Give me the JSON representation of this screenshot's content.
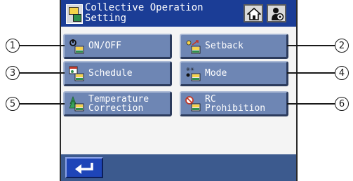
{
  "header": {
    "title": "Collective Operation\nSetting",
    "home_icon": "home-icon",
    "settings_icon": "user-settings-icon"
  },
  "menu": [
    {
      "label": "ON/OFF",
      "icon": "power-remote-icon",
      "callout": "1"
    },
    {
      "label": "Setback",
      "icon": "setback-icon",
      "callout": "2"
    },
    {
      "label": "Schedule",
      "icon": "schedule-icon",
      "callout": "3"
    },
    {
      "label": "Mode",
      "icon": "mode-icon",
      "callout": "4"
    },
    {
      "label": "Temperature\nCorrection",
      "icon": "temperature-correction-icon",
      "callout": "5"
    },
    {
      "label": "RC\nProhibition",
      "icon": "rc-prohibition-icon",
      "callout": "6"
    }
  ],
  "footer": {
    "back_icon": "return-arrow-icon"
  },
  "colors": {
    "title_bar": "#1b3d96",
    "button": "#6e86b4",
    "bottom_bar": "#3c5a8e",
    "back_button": "#1e45b8"
  }
}
